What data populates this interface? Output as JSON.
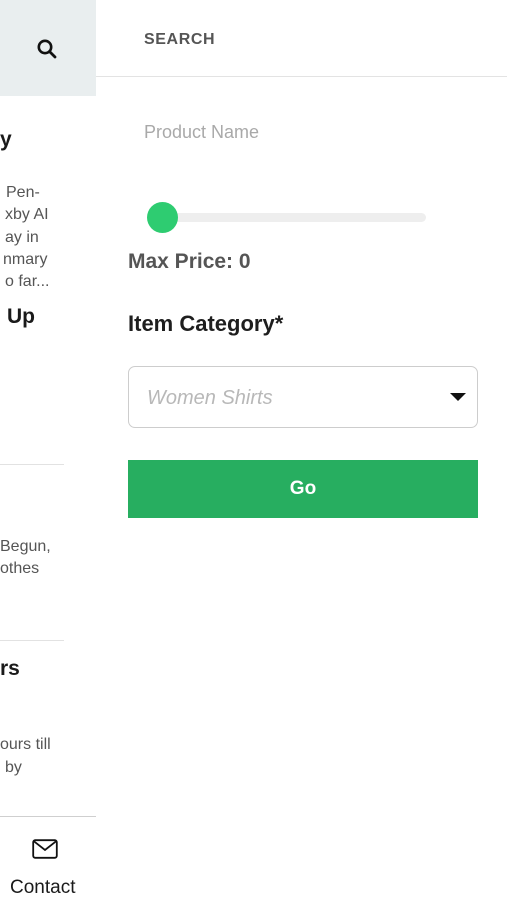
{
  "background_page": {
    "articles": [
      {
        "title": "y",
        "snippet_lines": [
          "Pen-",
          "xby AI",
          "ay in",
          "nmary",
          "o far..."
        ]
      },
      {
        "title": "Up",
        "snippet_lines": []
      },
      {
        "title": "",
        "snippet_lines": [
          "Begun,",
          "othes"
        ]
      },
      {
        "title": "rs",
        "snippet_lines": [
          "ours till",
          "by"
        ]
      }
    ],
    "footer": {
      "contact_label": "Contact"
    }
  },
  "search_panel": {
    "title": "SEARCH",
    "product_name_placeholder": "Product Name",
    "product_name_value": "",
    "price_slider": {
      "value": 0
    },
    "max_price_label": "Max Price: 0",
    "category_label": "Item Category*",
    "category_selected": "Women Shirts",
    "go_label": "Go"
  },
  "colors": {
    "accent_green": "#27ae60",
    "slider_thumb": "#2ecc71",
    "search_bar_bg": "#e9eeef"
  },
  "icons": [
    "search-icon",
    "mail-icon",
    "dropdown-caret-icon"
  ]
}
